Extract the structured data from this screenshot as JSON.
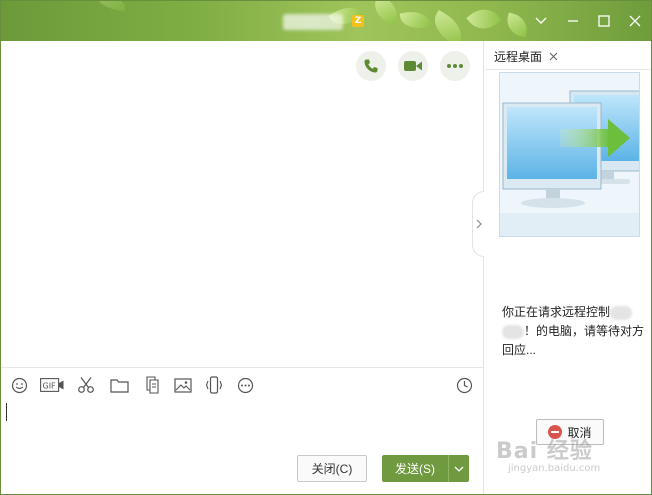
{
  "titlebar": {
    "title": "",
    "badge": "Z",
    "buttons": [
      "chevron-down",
      "minimize",
      "maximize",
      "close"
    ]
  },
  "chat": {
    "header_actions": [
      "phone-call",
      "video-call",
      "more"
    ]
  },
  "toolbar": {
    "icons": [
      "emoji",
      "gif",
      "screenshot-scissors",
      "folder",
      "file-transfer",
      "image",
      "shake",
      "more",
      "history-clock"
    ]
  },
  "input": {
    "value": "",
    "close_label": "关闭(C)",
    "send_label": "发送(S)"
  },
  "right_panel": {
    "tab_label": "远程桌面",
    "status_line1": "你正在请求远程控制",
    "status_line2": "！的电脑，请等待对方回应...",
    "cancel_label": "取消"
  },
  "watermark": {
    "main": "Bai 经验",
    "sub": "jingyan.baidu.com"
  },
  "colors": {
    "accent": "#6f9a3f",
    "titlebar": "#7fae44",
    "icon_green": "#5f8a35"
  }
}
